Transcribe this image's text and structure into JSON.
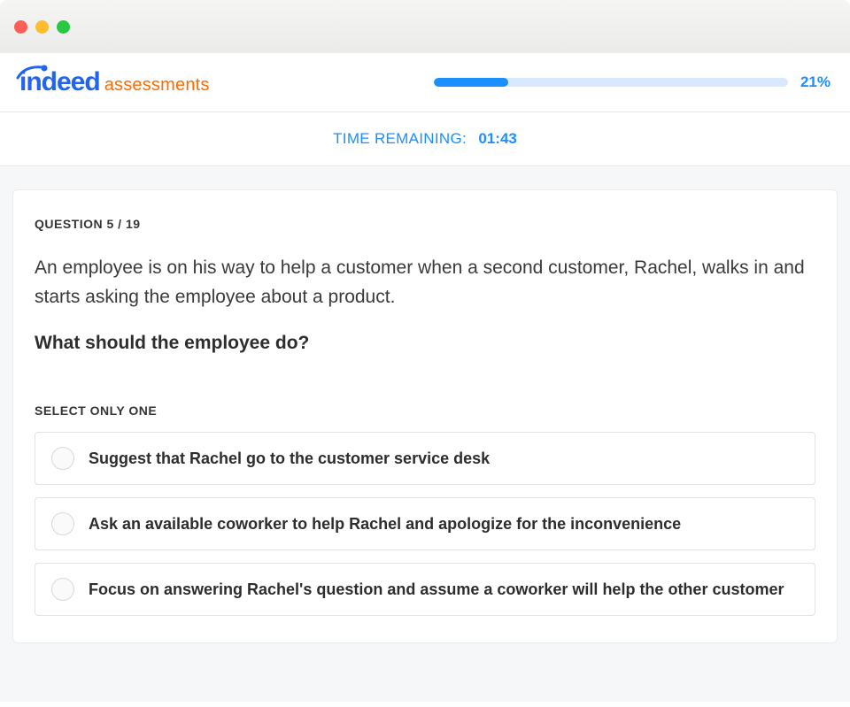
{
  "logo": {
    "brand": "indeed",
    "product": "assessments"
  },
  "progress": {
    "percent_label": "21%",
    "percent_value": 21
  },
  "timer": {
    "label": "TIME REMAINING:",
    "value": "01:43"
  },
  "question": {
    "counter": "QUESTION 5 / 19",
    "scenario": "An employee is on his way to help a customer when a second customer, Rachel, walks in and starts asking the employee about a product.",
    "prompt": "What should the employee do?",
    "select_hint": "SELECT ONLY ONE",
    "options": [
      {
        "text": "Suggest that Rachel go to the customer service desk"
      },
      {
        "text": "Ask an available coworker to help Rachel and apologize for the inconvenience"
      },
      {
        "text": "Focus on answering Rachel's question and assume a coworker will help the other customer"
      }
    ]
  }
}
